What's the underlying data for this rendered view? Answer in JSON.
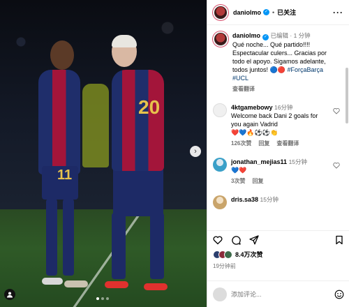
{
  "post": {
    "username": "daniolmo",
    "follow_state": "已关注",
    "edited_label": "已编辑",
    "time": "1 分钟",
    "caption_lines": [
      "Qué noche... Qué partido!!!!",
      "Espectacular culers... Gracias por",
      "todo el apoyo. Sigamos adelante,",
      "todos juntos!"
    ],
    "hashtag": "#ForçaBarça",
    "hashtag2": "#UCL",
    "translate": "查看翻译",
    "caption_emoji": "🔵🔴"
  },
  "comments": [
    {
      "name": "4ktgamebowy",
      "time": "16分钟",
      "text": "Welcome back Dani 2 goals for you again Vadrid",
      "emoji": "❤️💙🔥⚽⚽👏",
      "likes": "126次赞",
      "reply": "回复",
      "translate": "查看翻译",
      "avatar_color": "#f0f0f0"
    },
    {
      "name": "jonathan_mejias11",
      "time": "15分钟",
      "text": "",
      "emoji": "💙❤️",
      "likes": "3次赞",
      "reply": "回复",
      "translate": "",
      "avatar_color": "#3aa0c8"
    },
    {
      "name": "dris.sa38",
      "time": "15分钟",
      "text": "",
      "emoji": "",
      "likes": "",
      "reply": "",
      "translate": "",
      "avatar_color": "#c9a46a"
    }
  ],
  "stats": {
    "likes": "8.4万次赞",
    "time_ago": "19分钟前"
  },
  "composer": {
    "placeholder": "添加评论..."
  },
  "photo": {
    "jersey_left": "11",
    "jersey_right": "20",
    "slides": 3,
    "active_slide": 1
  },
  "colors": {
    "verified": "#0095f6",
    "accent_blue": "#1f2e6b",
    "accent_red": "#a3153a",
    "gold": "#e7c24c"
  }
}
